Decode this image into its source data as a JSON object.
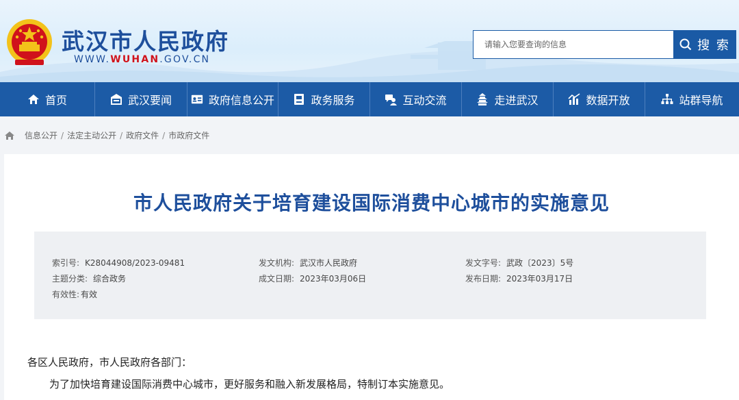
{
  "header": {
    "site_name": "武汉市人民政府",
    "url_prefix": "WWW.",
    "url_highlight": "WUHAN",
    "url_suffix": ".GOV.CN",
    "search_placeholder": "请输入您要查询的信息",
    "search_button": "搜 索"
  },
  "nav": {
    "items": [
      {
        "label": "首页",
        "icon": "home-icon"
      },
      {
        "label": "武汉要闻",
        "icon": "news-icon"
      },
      {
        "label": "政府信息公开",
        "icon": "info-card-icon"
      },
      {
        "label": "政务服务",
        "icon": "service-icon"
      },
      {
        "label": "互动交流",
        "icon": "interaction-icon"
      },
      {
        "label": "走进武汉",
        "icon": "tower-icon"
      },
      {
        "label": "数据开放",
        "icon": "chart-icon"
      },
      {
        "label": "站群导航",
        "icon": "sitemap-icon"
      }
    ]
  },
  "breadcrumb": {
    "items": [
      "信息公开",
      "法定主动公开",
      "政府文件",
      "市政府文件"
    ],
    "separator": "/"
  },
  "article": {
    "title": "市人民政府关于培育建设国际消费中心城市的实施意见",
    "meta": {
      "index_label": "索引号:",
      "index_value": "K28044908/2023-09481",
      "issuer_label": "发文机构:",
      "issuer_value": "武汉市人民政府",
      "doc_no_label": "发文字号:",
      "doc_no_value": "武政〔2023〕5号",
      "category_label": "主题分类:",
      "category_value": "综合政务",
      "created_label": "成文日期:",
      "created_value": "2023年03月06日",
      "published_label": "发布日期:",
      "published_value": "2023年03月17日",
      "validity_label": "有效性:",
      "validity_value": "有效"
    },
    "salutation": "各区人民政府，市人民政府各部门：",
    "paragraph1": "为了加快培育建设国际消费中心城市，更好服务和融入新发展格局，特制订本实施意见。"
  },
  "colors": {
    "brand_blue": "#1c5ba6",
    "title_blue": "#1e4f9c",
    "url_red": "#d0121b",
    "meta_bg": "#eef0f3"
  }
}
